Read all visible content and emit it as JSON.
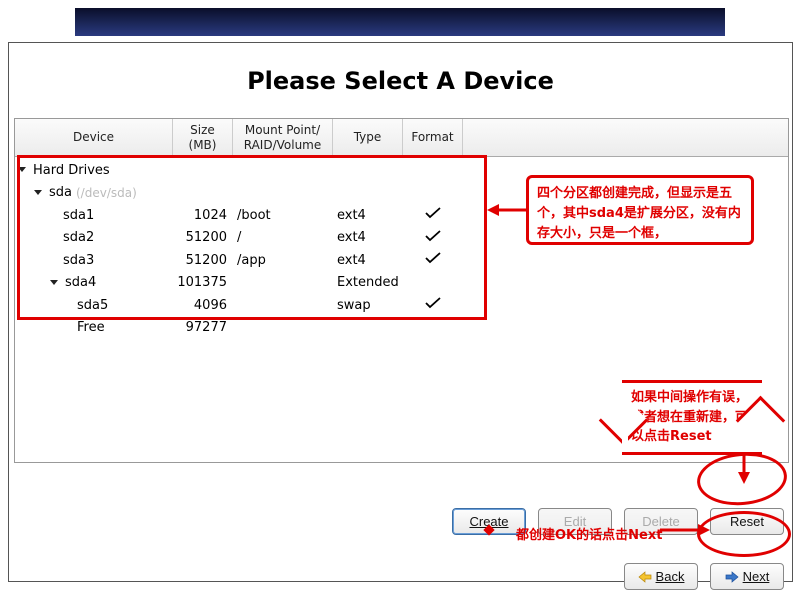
{
  "title": "Please Select A Device",
  "columns": {
    "device": "Device",
    "size": "Size\n(MB)",
    "mount": "Mount Point/\nRAID/Volume",
    "type": "Type",
    "format": "Format"
  },
  "tree": {
    "root_label": "Hard Drives",
    "disk": {
      "name": "sda",
      "path": "(/dev/sda)"
    },
    "partitions": [
      {
        "name": "sda1",
        "size": "1024",
        "mount": "/boot",
        "type": "ext4",
        "format": true,
        "indent": 3,
        "expander": false
      },
      {
        "name": "sda2",
        "size": "51200",
        "mount": "/",
        "type": "ext4",
        "format": true,
        "indent": 3,
        "expander": false
      },
      {
        "name": "sda3",
        "size": "51200",
        "mount": "/app",
        "type": "ext4",
        "format": true,
        "indent": 3,
        "expander": false
      },
      {
        "name": "sda4",
        "size": "101375",
        "mount": "",
        "type": "Extended",
        "format": false,
        "indent": 2,
        "expander": true
      },
      {
        "name": "sda5",
        "size": "4096",
        "mount": "",
        "type": "swap",
        "format": true,
        "indent": 4,
        "expander": false
      },
      {
        "name": "Free",
        "size": "97277",
        "mount": "",
        "type": "",
        "format": false,
        "indent": 4,
        "expander": false
      }
    ]
  },
  "buttons": {
    "create": "Create",
    "edit": "Edit",
    "delete": "Delete",
    "reset": "Reset",
    "back": "Back",
    "next": "Next"
  },
  "annotations": {
    "a1": "四个分区都创建完成，但显示是五个，其中sda4是扩展分区，没有内存大小，只是一个框，",
    "a2": "如果中间操作有误，或者想在重新建，可以点击Reset",
    "a3": "都创建OK的话点击Next"
  }
}
